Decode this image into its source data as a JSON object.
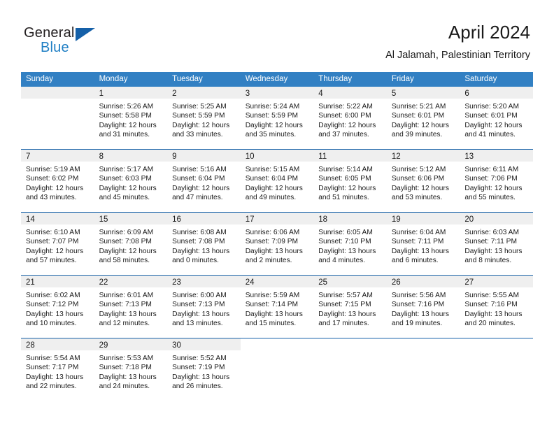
{
  "brand": {
    "name_top": "General",
    "name_bottom": "Blue",
    "triangle_color": "#1560a8",
    "blue_color": "#1f7fc4"
  },
  "header": {
    "month_title": "April 2024",
    "location": "Al Jalamah, Palestinian Territory"
  },
  "theme": {
    "header_bar": "#3280c3",
    "row_divider": "#1560a8",
    "daynum_band": "#efefef",
    "text": "#1a1a1a"
  },
  "calendar": {
    "weekdays": [
      "Sunday",
      "Monday",
      "Tuesday",
      "Wednesday",
      "Thursday",
      "Friday",
      "Saturday"
    ],
    "weeks": [
      [
        {
          "day": "",
          "lines": []
        },
        {
          "day": "1",
          "lines": [
            "Sunrise: 5:26 AM",
            "Sunset: 5:58 PM",
            "Daylight: 12 hours",
            "and 31 minutes."
          ]
        },
        {
          "day": "2",
          "lines": [
            "Sunrise: 5:25 AM",
            "Sunset: 5:59 PM",
            "Daylight: 12 hours",
            "and 33 minutes."
          ]
        },
        {
          "day": "3",
          "lines": [
            "Sunrise: 5:24 AM",
            "Sunset: 5:59 PM",
            "Daylight: 12 hours",
            "and 35 minutes."
          ]
        },
        {
          "day": "4",
          "lines": [
            "Sunrise: 5:22 AM",
            "Sunset: 6:00 PM",
            "Daylight: 12 hours",
            "and 37 minutes."
          ]
        },
        {
          "day": "5",
          "lines": [
            "Sunrise: 5:21 AM",
            "Sunset: 6:01 PM",
            "Daylight: 12 hours",
            "and 39 minutes."
          ]
        },
        {
          "day": "6",
          "lines": [
            "Sunrise: 5:20 AM",
            "Sunset: 6:01 PM",
            "Daylight: 12 hours",
            "and 41 minutes."
          ]
        }
      ],
      [
        {
          "day": "7",
          "lines": [
            "Sunrise: 5:19 AM",
            "Sunset: 6:02 PM",
            "Daylight: 12 hours",
            "and 43 minutes."
          ]
        },
        {
          "day": "8",
          "lines": [
            "Sunrise: 5:17 AM",
            "Sunset: 6:03 PM",
            "Daylight: 12 hours",
            "and 45 minutes."
          ]
        },
        {
          "day": "9",
          "lines": [
            "Sunrise: 5:16 AM",
            "Sunset: 6:04 PM",
            "Daylight: 12 hours",
            "and 47 minutes."
          ]
        },
        {
          "day": "10",
          "lines": [
            "Sunrise: 5:15 AM",
            "Sunset: 6:04 PM",
            "Daylight: 12 hours",
            "and 49 minutes."
          ]
        },
        {
          "day": "11",
          "lines": [
            "Sunrise: 5:14 AM",
            "Sunset: 6:05 PM",
            "Daylight: 12 hours",
            "and 51 minutes."
          ]
        },
        {
          "day": "12",
          "lines": [
            "Sunrise: 5:12 AM",
            "Sunset: 6:06 PM",
            "Daylight: 12 hours",
            "and 53 minutes."
          ]
        },
        {
          "day": "13",
          "lines": [
            "Sunrise: 6:11 AM",
            "Sunset: 7:06 PM",
            "Daylight: 12 hours",
            "and 55 minutes."
          ]
        }
      ],
      [
        {
          "day": "14",
          "lines": [
            "Sunrise: 6:10 AM",
            "Sunset: 7:07 PM",
            "Daylight: 12 hours",
            "and 57 minutes."
          ]
        },
        {
          "day": "15",
          "lines": [
            "Sunrise: 6:09 AM",
            "Sunset: 7:08 PM",
            "Daylight: 12 hours",
            "and 58 minutes."
          ]
        },
        {
          "day": "16",
          "lines": [
            "Sunrise: 6:08 AM",
            "Sunset: 7:08 PM",
            "Daylight: 13 hours",
            "and 0 minutes."
          ]
        },
        {
          "day": "17",
          "lines": [
            "Sunrise: 6:06 AM",
            "Sunset: 7:09 PM",
            "Daylight: 13 hours",
            "and 2 minutes."
          ]
        },
        {
          "day": "18",
          "lines": [
            "Sunrise: 6:05 AM",
            "Sunset: 7:10 PM",
            "Daylight: 13 hours",
            "and 4 minutes."
          ]
        },
        {
          "day": "19",
          "lines": [
            "Sunrise: 6:04 AM",
            "Sunset: 7:11 PM",
            "Daylight: 13 hours",
            "and 6 minutes."
          ]
        },
        {
          "day": "20",
          "lines": [
            "Sunrise: 6:03 AM",
            "Sunset: 7:11 PM",
            "Daylight: 13 hours",
            "and 8 minutes."
          ]
        }
      ],
      [
        {
          "day": "21",
          "lines": [
            "Sunrise: 6:02 AM",
            "Sunset: 7:12 PM",
            "Daylight: 13 hours",
            "and 10 minutes."
          ]
        },
        {
          "day": "22",
          "lines": [
            "Sunrise: 6:01 AM",
            "Sunset: 7:13 PM",
            "Daylight: 13 hours",
            "and 12 minutes."
          ]
        },
        {
          "day": "23",
          "lines": [
            "Sunrise: 6:00 AM",
            "Sunset: 7:13 PM",
            "Daylight: 13 hours",
            "and 13 minutes."
          ]
        },
        {
          "day": "24",
          "lines": [
            "Sunrise: 5:59 AM",
            "Sunset: 7:14 PM",
            "Daylight: 13 hours",
            "and 15 minutes."
          ]
        },
        {
          "day": "25",
          "lines": [
            "Sunrise: 5:57 AM",
            "Sunset: 7:15 PM",
            "Daylight: 13 hours",
            "and 17 minutes."
          ]
        },
        {
          "day": "26",
          "lines": [
            "Sunrise: 5:56 AM",
            "Sunset: 7:16 PM",
            "Daylight: 13 hours",
            "and 19 minutes."
          ]
        },
        {
          "day": "27",
          "lines": [
            "Sunrise: 5:55 AM",
            "Sunset: 7:16 PM",
            "Daylight: 13 hours",
            "and 20 minutes."
          ]
        }
      ],
      [
        {
          "day": "28",
          "lines": [
            "Sunrise: 5:54 AM",
            "Sunset: 7:17 PM",
            "Daylight: 13 hours",
            "and 22 minutes."
          ]
        },
        {
          "day": "29",
          "lines": [
            "Sunrise: 5:53 AM",
            "Sunset: 7:18 PM",
            "Daylight: 13 hours",
            "and 24 minutes."
          ]
        },
        {
          "day": "30",
          "lines": [
            "Sunrise: 5:52 AM",
            "Sunset: 7:19 PM",
            "Daylight: 13 hours",
            "and 26 minutes."
          ]
        },
        {
          "day": "",
          "lines": []
        },
        {
          "day": "",
          "lines": []
        },
        {
          "day": "",
          "lines": []
        },
        {
          "day": "",
          "lines": []
        }
      ]
    ]
  }
}
